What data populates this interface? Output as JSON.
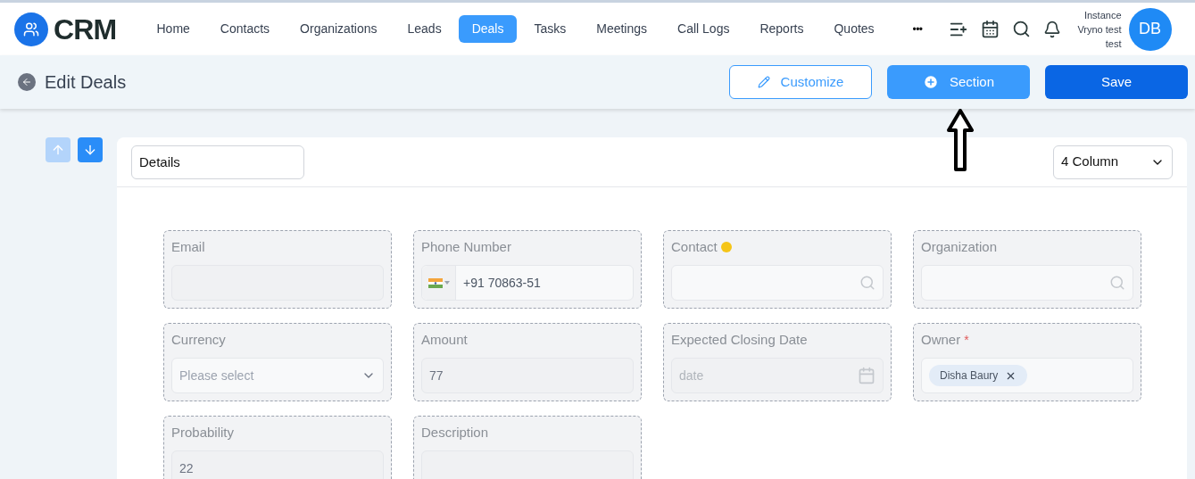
{
  "logo": {
    "text": "CRM"
  },
  "nav": [
    {
      "label": "Home",
      "selected": false
    },
    {
      "label": "Contacts",
      "selected": false
    },
    {
      "label": "Organizations",
      "selected": false
    },
    {
      "label": "Leads",
      "selected": false
    },
    {
      "label": "Deals",
      "selected": true
    },
    {
      "label": "Tasks",
      "selected": false
    },
    {
      "label": "Meetings",
      "selected": false
    },
    {
      "label": "Call Logs",
      "selected": false
    },
    {
      "label": "Reports",
      "selected": false
    },
    {
      "label": "Quotes",
      "selected": false
    }
  ],
  "more": "•••",
  "user": {
    "instance": [
      "Instance",
      "Vryno test",
      "test"
    ],
    "initials": "DB"
  },
  "page_title": "Edit Deals",
  "actions": [
    {
      "label": "Customize",
      "kind": "outline"
    },
    {
      "label": "Section",
      "kind": "secondary"
    },
    {
      "label": "Save",
      "kind": "primary"
    }
  ],
  "move_buttons": [
    {
      "kind": "up",
      "disabled": true
    },
    {
      "kind": "down",
      "disabled": false
    }
  ],
  "section": {
    "name": "Details",
    "columns": "4 Column"
  },
  "required_mark": "*",
  "fields": [
    {
      "label": "Email",
      "kind": "text",
      "required": false,
      "info": false
    },
    {
      "label": "Phone Number",
      "kind": "phone",
      "value": "+91 70863-51",
      "required": false,
      "info": false
    },
    {
      "label": "Contact",
      "kind": "search",
      "required": false,
      "info": true
    },
    {
      "label": "Organization",
      "kind": "search",
      "required": false,
      "info": false
    },
    {
      "label": "Currency",
      "kind": "select",
      "placeholder": "Please select",
      "required": false,
      "info": false
    },
    {
      "label": "Amount",
      "kind": "text",
      "value": "77",
      "required": false,
      "info": false
    },
    {
      "label": "Expected Closing Date",
      "kind": "date",
      "placeholder": "date",
      "required": false,
      "info": false
    },
    {
      "label": "Owner",
      "kind": "owner",
      "tag": "Disha Baury",
      "required": true,
      "info": false
    },
    {
      "label": "Probability",
      "kind": "text",
      "value": "22",
      "required": false,
      "info": false
    },
    {
      "label": "Description",
      "kind": "text",
      "required": false,
      "info": false
    }
  ]
}
